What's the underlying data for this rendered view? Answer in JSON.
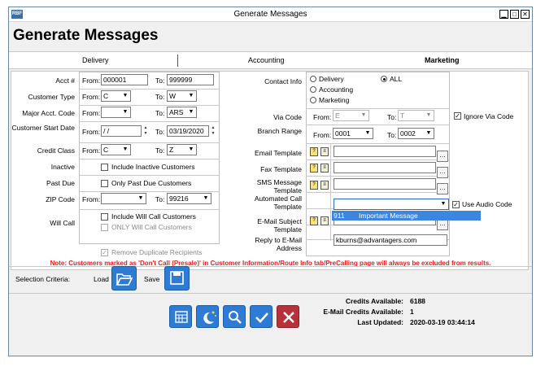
{
  "window": {
    "title": "Generate Messages",
    "app_icon": "RBF"
  },
  "heading": "Generate Messages",
  "tabs": [
    "Delivery",
    "Accounting",
    "Marketing"
  ],
  "left": {
    "acct": {
      "label": "Acct #",
      "from_label": "From:",
      "from": "000001",
      "to_label": "To:",
      "to": "999999"
    },
    "customer_type": {
      "label": "Customer Type",
      "from_label": "From:",
      "from": "C",
      "to_label": "To:",
      "to": "W"
    },
    "major_acct": {
      "label": "Major Acct. Code",
      "from_label": "From:",
      "from": "",
      "to_label": "To:",
      "to": "ARS"
    },
    "start_date": {
      "label": "Customer Start Date",
      "from_label": "From:",
      "from": " / /",
      "to_label": "To:",
      "to": "03/19/2020"
    },
    "credit_class": {
      "label": "Credit Class",
      "from_label": "From:",
      "from": "C",
      "to_label": "To:",
      "to": "Z"
    },
    "inactive": {
      "label": "Inactive",
      "check_label": "Include Inactive Customers"
    },
    "past_due": {
      "label": "Past Due",
      "check_label": "Only Past Due Customers"
    },
    "zip": {
      "label": "ZIP Code",
      "from_label": "From:",
      "from": "",
      "to_label": "To:",
      "to": "99216"
    },
    "will_call": {
      "label": "Will Call",
      "check1": "Include Will Call Customers",
      "check2": "ONLY Will Call Customers"
    },
    "remove_dup": "Remove Duplicate Recipients"
  },
  "right": {
    "contact_info": {
      "label": "Contact Info",
      "options": [
        "Delivery",
        "Accounting",
        "Marketing"
      ],
      "all_label": "ALL"
    },
    "via_code": {
      "label": "Via Code",
      "from_label": "From:",
      "from": "E",
      "to_label": "To:",
      "to": "T",
      "ignore_label": "Ignore Via Code"
    },
    "branch_range": {
      "label": "Branch Range",
      "from_label": "From:",
      "from": "0001",
      "to_label": "To:",
      "to": "0002"
    },
    "email_template": {
      "label": "Email Template"
    },
    "fax_template": {
      "label": "Fax Template"
    },
    "sms_template": {
      "label": "SMS Message Template"
    },
    "auto_call": {
      "label": "Automated Call Template",
      "use_audio_label": "Use Audio Code"
    },
    "email_subject": {
      "label": "E-Mail Subject Template"
    },
    "reply_to": {
      "label": "Reply to E-Mail Address",
      "value": "kburns@advantagers.com"
    },
    "dropdown_item": {
      "code": "911",
      "name": "Important Message"
    }
  },
  "note": "Note: Customers marked as 'Don't Call (Presale)' in Customer Information/Route Info tab/PreCalling page will always be excluded from results.",
  "selection": {
    "label": "Selection Criteria:",
    "load": "Load",
    "save": "Save"
  },
  "credits": {
    "available_label": "Credits Available:",
    "available": "6188",
    "email_label": "E-Mail Credits Available:",
    "email": "1",
    "updated_label": "Last Updated:",
    "updated": "2020-03-19 03:44:14"
  },
  "icons": [
    "calendar-icon",
    "moon-stars-icon",
    "search-icon",
    "check-icon",
    "close-icon"
  ]
}
